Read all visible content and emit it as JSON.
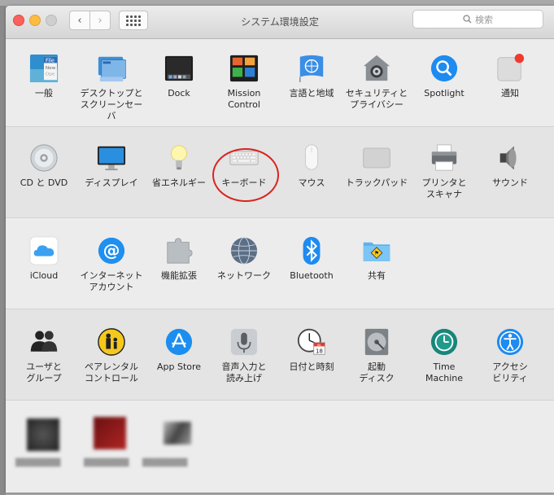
{
  "window": {
    "title": "システム環境設定",
    "search_placeholder": "検索",
    "nav_back": "‹",
    "nav_forward": "›"
  },
  "rows": [
    [
      {
        "label": "一般",
        "icon": "general-icon"
      },
      {
        "label": "デスクトップと\nスクリーンセーバ",
        "icon": "desktop-icon"
      },
      {
        "label": "Dock",
        "icon": "dock-icon"
      },
      {
        "label": "Mission\nControl",
        "icon": "mission-control-icon"
      },
      {
        "label": "言語と地域",
        "icon": "language-icon"
      },
      {
        "label": "セキュリティと\nプライバシー",
        "icon": "security-icon"
      },
      {
        "label": "Spotlight",
        "icon": "spotlight-icon"
      },
      {
        "label": "通知",
        "icon": "notifications-icon"
      }
    ],
    [
      {
        "label": "CD と DVD",
        "icon": "cd-dvd-icon"
      },
      {
        "label": "ディスプレイ",
        "icon": "display-icon"
      },
      {
        "label": "省エネルギー",
        "icon": "energy-icon"
      },
      {
        "label": "キーボード",
        "icon": "keyboard-icon"
      },
      {
        "label": "マウス",
        "icon": "mouse-icon"
      },
      {
        "label": "トラックパッド",
        "icon": "trackpad-icon"
      },
      {
        "label": "プリンタと\nスキャナ",
        "icon": "printer-icon"
      },
      {
        "label": "サウンド",
        "icon": "sound-icon"
      }
    ],
    [
      {
        "label": "iCloud",
        "icon": "icloud-icon"
      },
      {
        "label": "インターネット\nアカウント",
        "icon": "internet-accounts-icon"
      },
      {
        "label": "機能拡張",
        "icon": "extensions-icon"
      },
      {
        "label": "ネットワーク",
        "icon": "network-icon"
      },
      {
        "label": "Bluetooth",
        "icon": "bluetooth-icon"
      },
      {
        "label": "共有",
        "icon": "sharing-icon"
      }
    ],
    [
      {
        "label": "ユーザと\nグループ",
        "icon": "users-icon"
      },
      {
        "label": "ペアレンタル\nコントロール",
        "icon": "parental-icon"
      },
      {
        "label": "App Store",
        "icon": "appstore-icon"
      },
      {
        "label": "音声入力と\n読み上げ",
        "icon": "dictation-icon"
      },
      {
        "label": "日付と時刻",
        "icon": "datetime-icon"
      },
      {
        "label": "起動\nディスク",
        "icon": "startup-disk-icon"
      },
      {
        "label": "Time\nMachine",
        "icon": "timemachine-icon"
      },
      {
        "label": "アクセシ\nビリティ",
        "icon": "accessibility-icon"
      }
    ]
  ],
  "calendar": {
    "month": "JUL",
    "day": "18"
  },
  "colors": {
    "highlight_circle": "#d9241e",
    "accent_blue": "#1a8cf0"
  }
}
